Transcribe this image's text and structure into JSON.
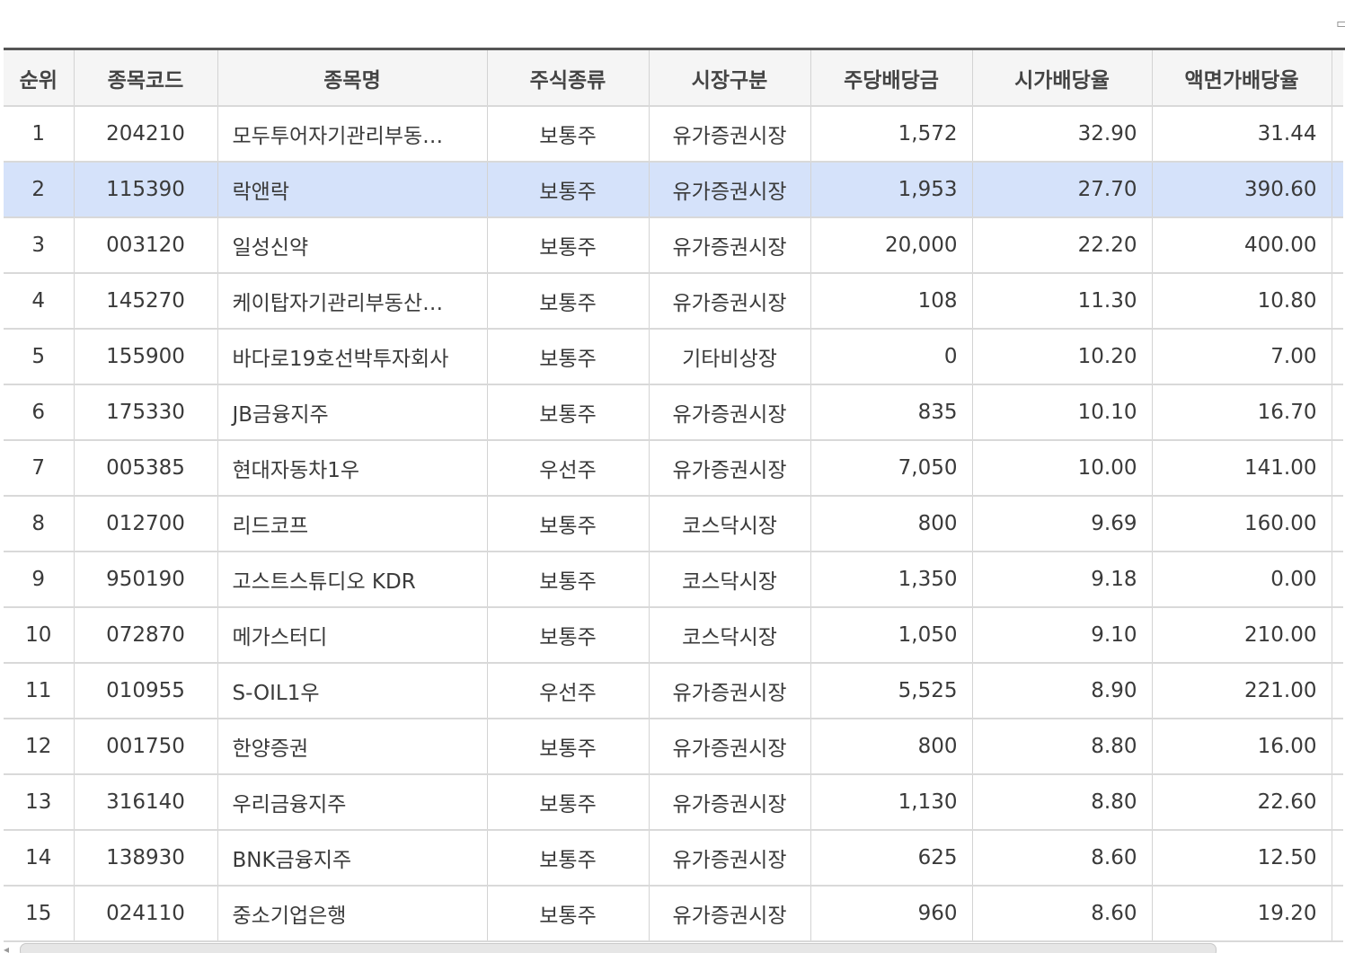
{
  "corner_icon": "window-restore-icon",
  "table": {
    "headers": [
      "순위",
      "종목코드",
      "종목명",
      "주식종류",
      "시장구분",
      "주당배당금",
      "시가배당율",
      "액면가배당율"
    ],
    "rows": [
      [
        "1",
        "204210",
        "모두투어자기관리부동…",
        "보통주",
        "유가증권시장",
        "1,572",
        "32.90",
        "31.44"
      ],
      [
        "2",
        "115390",
        "락앤락",
        "보통주",
        "유가증권시장",
        "1,953",
        "27.70",
        "390.60"
      ],
      [
        "3",
        "003120",
        "일성신약",
        "보통주",
        "유가증권시장",
        "20,000",
        "22.20",
        "400.00"
      ],
      [
        "4",
        "145270",
        "케이탑자기관리부동산…",
        "보통주",
        "유가증권시장",
        "108",
        "11.30",
        "10.80"
      ],
      [
        "5",
        "155900",
        "바다로19호선박투자회사",
        "보통주",
        "기타비상장",
        "0",
        "10.20",
        "7.00"
      ],
      [
        "6",
        "175330",
        "JB금융지주",
        "보통주",
        "유가증권시장",
        "835",
        "10.10",
        "16.70"
      ],
      [
        "7",
        "005385",
        "현대자동차1우",
        "우선주",
        "유가증권시장",
        "7,050",
        "10.00",
        "141.00"
      ],
      [
        "8",
        "012700",
        "리드코프",
        "보통주",
        "코스닥시장",
        "800",
        "9.69",
        "160.00"
      ],
      [
        "9",
        "950190",
        "고스트스튜디오 KDR",
        "보통주",
        "코스닥시장",
        "1,350",
        "9.18",
        "0.00"
      ],
      [
        "10",
        "072870",
        "메가스터디",
        "보통주",
        "코스닥시장",
        "1,050",
        "9.10",
        "210.00"
      ],
      [
        "11",
        "010955",
        "S-OIL1우",
        "우선주",
        "유가증권시장",
        "5,525",
        "8.90",
        "221.00"
      ],
      [
        "12",
        "001750",
        "한양증권",
        "보통주",
        "유가증권시장",
        "800",
        "8.80",
        "16.00"
      ],
      [
        "13",
        "316140",
        "우리금융지주",
        "보통주",
        "유가증권시장",
        "1,130",
        "8.80",
        "22.60"
      ],
      [
        "14",
        "138930",
        "BNK금융지주",
        "보통주",
        "유가증권시장",
        "625",
        "8.60",
        "12.50"
      ],
      [
        "15",
        "024110",
        "중소기업은행",
        "보통주",
        "유가증권시장",
        "960",
        "8.60",
        "19.20"
      ]
    ],
    "selected_row": 1
  },
  "colors": {
    "header_bg": "#f5f5f5",
    "selected_row_bg": "#d5e2fa",
    "top_rule": "#555555"
  }
}
